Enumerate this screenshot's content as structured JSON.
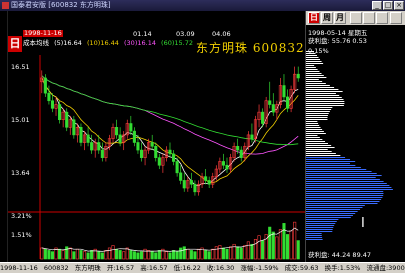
{
  "window": {
    "title": "国泰君安版 [600832 东方明珠]"
  },
  "header": {
    "date": "1998-11-16",
    "label_cost": "成本均线",
    "ma": [
      {
        "label": "(5)16.64",
        "color": "#ffffff"
      },
      {
        "label": "(10)16.44",
        "color": "#f2d000"
      },
      {
        "label": "(30)16.14",
        "color": "#ff55ff"
      },
      {
        "label": "(60)15.72",
        "color": "#33dd33"
      }
    ],
    "stock_name": "东方明珠",
    "stock_code": "600832"
  },
  "axis": {
    "price_labels": [
      "16.51",
      "15.01",
      "13.64"
    ],
    "volume_labels": [
      "3.21%",
      "1.51%"
    ],
    "top_dates": [
      "01.14",
      "03.09",
      "04.06"
    ]
  },
  "right_panel": {
    "tabs": [
      "日",
      "周",
      "月"
    ],
    "date_line": "1998-05-14 星期五",
    "profit_line": "获利盘: 55.76  0.53",
    "pct_label": "0.15%",
    "cost_line": "获利盘: 44.24  89.47"
  },
  "left_tab": "日",
  "status": {
    "date": "1998-11-16",
    "code": "600832",
    "name": "东方明珠",
    "open": "开:16.57",
    "high": "高:16.57",
    "low": "低:16.22",
    "close": "收:16.30",
    "change": "涨幅:-1.59%",
    "amplitude": "成交:59.63",
    "turnover": "换手:1.53%",
    "float": "流通盘:3900.00"
  },
  "chart_data": {
    "type": "candlestick",
    "title": "",
    "ylim": [
      12.9,
      16.8
    ],
    "vol_max": 3.5,
    "ohlc": [
      [
        16.2,
        16.5,
        15.9,
        16.3
      ],
      [
        16.3,
        16.4,
        15.8,
        15.9
      ],
      [
        15.9,
        16.1,
        15.6,
        15.7
      ],
      [
        15.7,
        15.9,
        15.4,
        15.5
      ],
      [
        15.5,
        15.8,
        15.3,
        15.6
      ],
      [
        15.6,
        15.7,
        15.1,
        15.2
      ],
      [
        15.2,
        15.5,
        15.0,
        15.4
      ],
      [
        15.4,
        15.5,
        14.9,
        15.0
      ],
      [
        15.0,
        15.3,
        14.8,
        15.2
      ],
      [
        15.2,
        15.3,
        14.7,
        14.8
      ],
      [
        14.8,
        15.1,
        14.6,
        15.0
      ],
      [
        15.0,
        15.1,
        14.5,
        14.6
      ],
      [
        14.6,
        14.9,
        14.4,
        14.8
      ],
      [
        14.8,
        15.0,
        14.5,
        14.6
      ],
      [
        14.6,
        14.8,
        14.3,
        14.4
      ],
      [
        14.4,
        14.7,
        14.2,
        14.6
      ],
      [
        14.6,
        14.8,
        14.3,
        14.4
      ],
      [
        14.4,
        14.6,
        14.1,
        14.2
      ],
      [
        14.2,
        14.6,
        14.1,
        14.5
      ],
      [
        14.5,
        14.8,
        14.4,
        14.7
      ],
      [
        14.7,
        15.1,
        14.6,
        15.0
      ],
      [
        15.0,
        15.2,
        14.7,
        14.8
      ],
      [
        14.8,
        15.0,
        14.5,
        14.6
      ],
      [
        14.6,
        14.9,
        14.4,
        14.8
      ],
      [
        14.8,
        15.2,
        14.7,
        15.1
      ],
      [
        15.1,
        15.3,
        14.8,
        14.9
      ],
      [
        14.9,
        15.0,
        14.5,
        14.6
      ],
      [
        14.6,
        14.8,
        14.3,
        14.4
      ],
      [
        14.4,
        14.6,
        14.1,
        14.2
      ],
      [
        14.2,
        14.5,
        14.0,
        14.4
      ],
      [
        14.4,
        14.7,
        14.3,
        14.6
      ],
      [
        14.6,
        14.8,
        14.4,
        14.5
      ],
      [
        14.5,
        14.6,
        14.1,
        14.2
      ],
      [
        14.2,
        14.3,
        13.9,
        14.0
      ],
      [
        14.0,
        14.3,
        13.8,
        14.2
      ],
      [
        14.2,
        14.5,
        14.1,
        14.4
      ],
      [
        14.4,
        14.6,
        14.2,
        14.3
      ],
      [
        14.3,
        14.4,
        14.0,
        14.1
      ],
      [
        14.1,
        14.2,
        13.7,
        13.8
      ],
      [
        13.8,
        14.0,
        13.5,
        13.6
      ],
      [
        13.6,
        13.8,
        13.3,
        13.4
      ],
      [
        13.4,
        13.7,
        13.3,
        13.6
      ],
      [
        13.6,
        13.8,
        13.4,
        13.5
      ],
      [
        13.5,
        13.6,
        13.2,
        13.3
      ],
      [
        13.3,
        13.6,
        13.2,
        13.5
      ],
      [
        13.5,
        13.8,
        13.4,
        13.7
      ],
      [
        13.7,
        13.9,
        13.5,
        13.6
      ],
      [
        13.6,
        13.7,
        13.4,
        13.5
      ],
      [
        13.5,
        13.8,
        13.4,
        13.7
      ],
      [
        13.7,
        14.0,
        13.6,
        13.9
      ],
      [
        13.9,
        14.2,
        13.8,
        14.1
      ],
      [
        14.1,
        14.3,
        13.9,
        14.0
      ],
      [
        14.0,
        14.2,
        13.8,
        13.9
      ],
      [
        13.9,
        14.3,
        13.8,
        14.2
      ],
      [
        14.2,
        14.6,
        14.1,
        14.5
      ],
      [
        14.5,
        14.7,
        14.3,
        14.4
      ],
      [
        14.4,
        14.5,
        14.1,
        14.2
      ],
      [
        14.2,
        14.6,
        14.1,
        14.5
      ],
      [
        14.5,
        14.9,
        14.4,
        14.8
      ],
      [
        14.8,
        15.1,
        14.6,
        14.7
      ],
      [
        14.7,
        15.3,
        14.6,
        15.2
      ],
      [
        15.2,
        15.6,
        15.0,
        15.4
      ],
      [
        15.4,
        15.5,
        15.0,
        15.1
      ],
      [
        15.1,
        15.8,
        15.0,
        15.7
      ],
      [
        15.7,
        16.2,
        15.5,
        15.6
      ],
      [
        15.6,
        15.9,
        15.3,
        15.4
      ],
      [
        15.4,
        15.7,
        15.2,
        15.6
      ],
      [
        15.6,
        16.3,
        15.5,
        16.1
      ],
      [
        16.1,
        16.4,
        15.7,
        15.8
      ],
      [
        15.8,
        16.0,
        15.4,
        15.5
      ],
      [
        15.5,
        16.1,
        15.4,
        16.0
      ],
      [
        16.0,
        16.6,
        15.9,
        16.4
      ],
      [
        16.4,
        16.6,
        16.2,
        16.3
      ]
    ],
    "volume": [
      0.9,
      0.8,
      0.7,
      0.6,
      0.9,
      0.8,
      0.7,
      1.0,
      0.9,
      0.6,
      0.8,
      0.7,
      0.6,
      0.5,
      0.7,
      0.8,
      0.6,
      0.5,
      0.7,
      0.9,
      1.1,
      0.8,
      0.7,
      0.6,
      0.9,
      0.7,
      0.6,
      0.5,
      0.6,
      0.8,
      0.7,
      0.6,
      0.5,
      0.7,
      0.8,
      0.6,
      0.5,
      0.7,
      0.6,
      0.9,
      1.0,
      0.8,
      0.7,
      0.6,
      0.8,
      0.9,
      0.7,
      0.6,
      0.8,
      1.0,
      1.1,
      0.9,
      0.8,
      1.0,
      1.2,
      1.0,
      0.9,
      1.1,
      1.4,
      1.2,
      1.6,
      1.9,
      1.5,
      2.0,
      2.6,
      2.2,
      1.8,
      2.4,
      2.9,
      2.0,
      2.3,
      3.0,
      1.5
    ],
    "ma_colors": [
      "#ffffff",
      "#f2d000",
      "#ff55ff",
      "#33dd33"
    ],
    "ma_periods": [
      5,
      10,
      30,
      60
    ]
  }
}
